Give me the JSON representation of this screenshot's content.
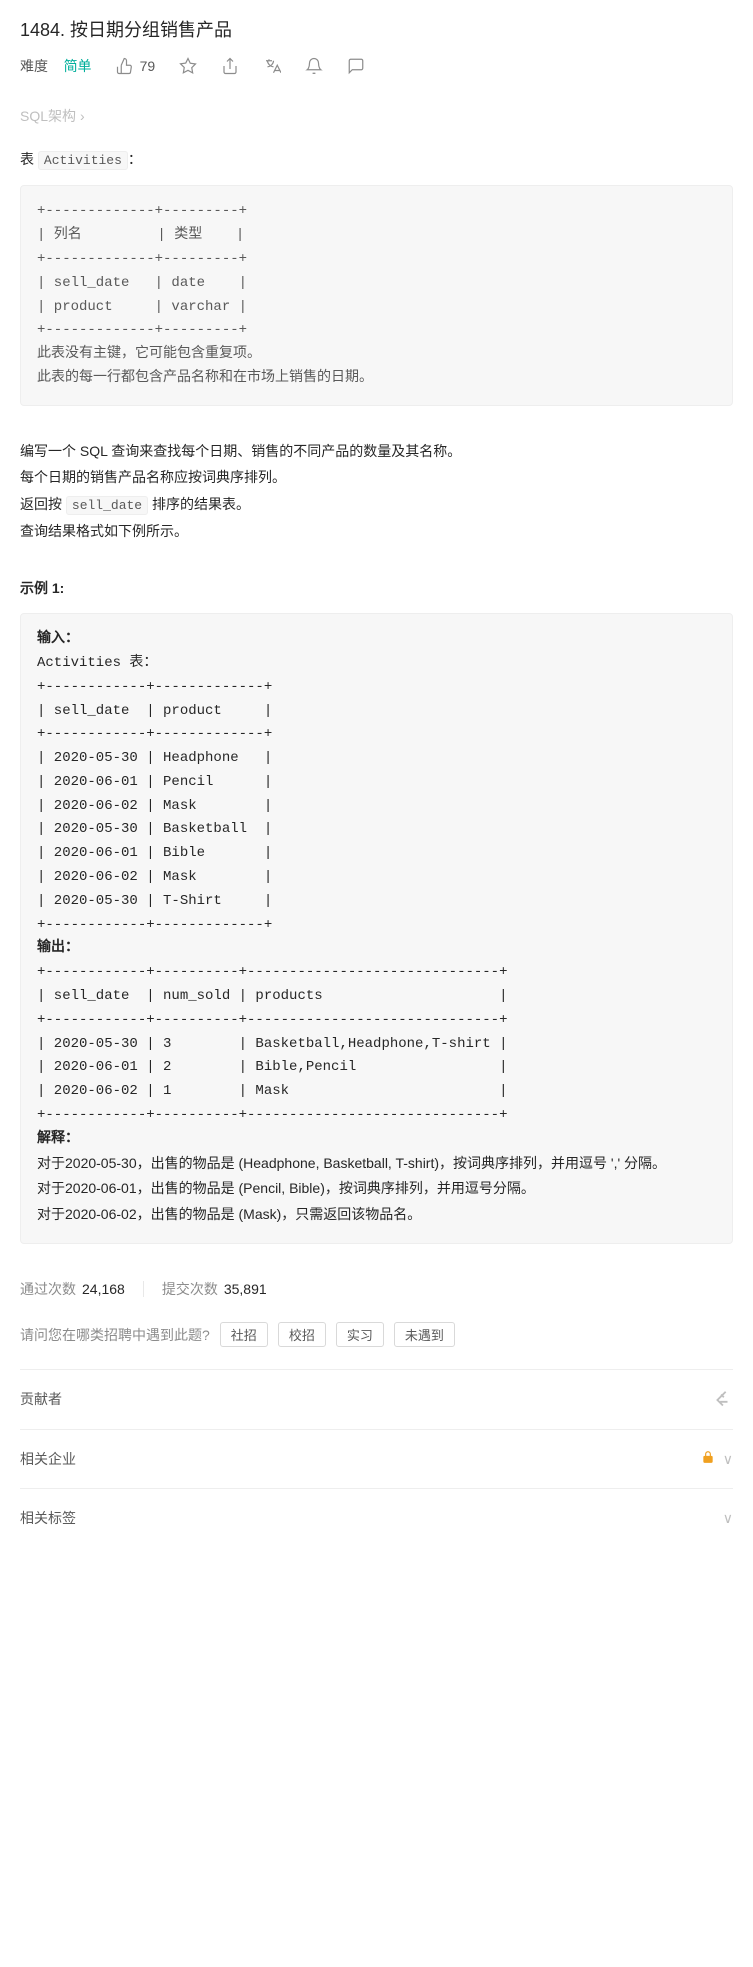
{
  "title": "1484. 按日期分组销售产品",
  "meta": {
    "difficulty_label": "难度",
    "difficulty": "简单",
    "likes": "79"
  },
  "schema_link": "SQL架构",
  "intro_prefix": "表 ",
  "intro_table": "Activities",
  "intro_suffix": "：",
  "schema_block": "+-------------+---------+\n| 列名         | 类型    |\n+-------------+---------+\n| sell_date   | date    |\n| product     | varchar |\n+-------------+---------+\n此表没有主键，它可能包含重复项。\n此表的每一行都包含产品名称和在市场上销售的日期。",
  "task": {
    "p1": "编写一个 SQL 查询来查找每个日期、销售的不同产品的数量及其名称。",
    "p2": "每个日期的销售产品名称应按词典序排列。",
    "p3a": "返回按 ",
    "p3code": "sell_date",
    "p3b": " 排序的结果表。",
    "p4": "查询结果格式如下例所示。"
  },
  "example_heading": "示例 1:",
  "example_block": "<b>输入：</b>\nActivities 表：\n+------------+-------------+\n| sell_date  | product     |\n+------------+-------------+\n| 2020-05-30 | Headphone   |\n| 2020-06-01 | Pencil      |\n| 2020-06-02 | Mask        |\n| 2020-05-30 | Basketball  |\n| 2020-06-01 | Bible       |\n| 2020-06-02 | Mask        |\n| 2020-05-30 | T-Shirt     |\n+------------+-------------+\n<b>输出：</b>\n+------------+----------+------------------------------+\n| sell_date  | num_sold | products                     |\n+------------+----------+------------------------------+\n| 2020-05-30 | 3        | Basketball,Headphone,T-shirt |\n| 2020-06-01 | 2        | Bible,Pencil                 |\n| 2020-06-02 | 1        | Mask                         |\n+------------+----------+------------------------------+\n<b>解释：</b>\n<span class='desc'>对于2020-05-30，出售的物品是 (Headphone, Basketball, T-shirt)，按词典序排列，并用逗号 ',' 分隔。\n对于2020-06-01，出售的物品是 (Pencil, Bible)，按词典序排列，并用逗号分隔。\n对于2020-06-02，出售的物品是 (Mask)，只需返回该物品名。</span>",
  "stats": {
    "pass_label": "通过次数",
    "pass_count": "24,168",
    "submit_label": "提交次数",
    "submit_count": "35,891"
  },
  "question": {
    "prompt": "请问您在哪类招聘中遇到此题?",
    "opts": [
      "社招",
      "校招",
      "实习",
      "未遇到"
    ]
  },
  "sections": {
    "contributor": "贡献者",
    "companies": "相关企业",
    "tags": "相关标签"
  }
}
